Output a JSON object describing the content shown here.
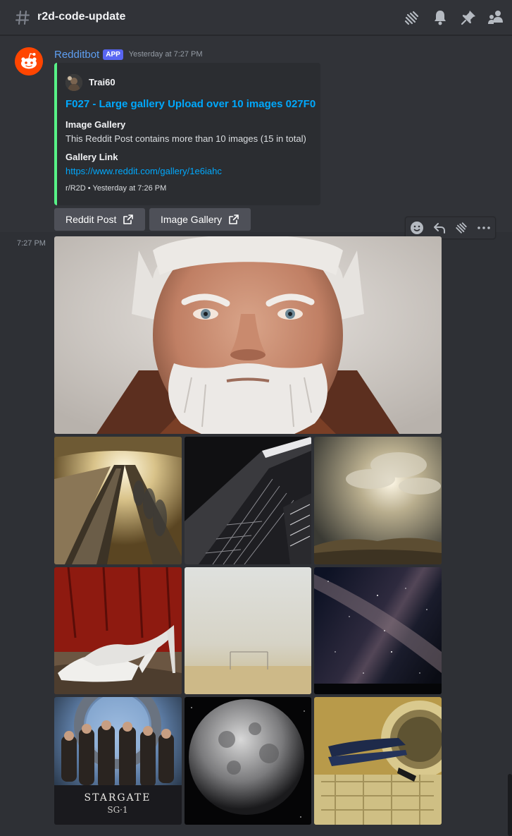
{
  "header": {
    "channel_name": "r2d-code-update",
    "icons": [
      "threads-icon",
      "bell-icon",
      "pin-icon",
      "members-icon"
    ]
  },
  "message": {
    "author": "Redditbot",
    "app_tag": "APP",
    "timestamp": "Yesterday at 7:27 PM",
    "side_time": "7:27 PM",
    "embed": {
      "accent_color": "#57f287",
      "author_name": "Trai60",
      "title": "F027 - Large gallery Upload over 10 images 027F0",
      "fields": [
        {
          "name": "Image Gallery",
          "value": "This Reddit Post contains more than 10 images (15 in total)"
        },
        {
          "name": "Gallery Link",
          "value": "https://www.reddit.com/gallery/1e6iahc"
        }
      ],
      "footer": "r/R2D • Yesterday at 7:26 PM"
    },
    "buttons": [
      {
        "label": "Reddit Post",
        "icon": "external-link-icon"
      },
      {
        "label": "Image Gallery",
        "icon": "external-link-icon"
      }
    ],
    "gallery": [
      {
        "name": "old-man-portrait-image",
        "alt": "portrait"
      },
      {
        "name": "escalator-image",
        "alt": "escalator"
      },
      {
        "name": "building-image",
        "alt": "building"
      },
      {
        "name": "clouds-image",
        "alt": "clouds"
      },
      {
        "name": "white-shoes-image",
        "alt": "shoes"
      },
      {
        "name": "foggy-desert-image",
        "alt": "fog"
      },
      {
        "name": "milky-way-image",
        "alt": "milky way"
      },
      {
        "name": "stargate-image",
        "alt": "stargate"
      },
      {
        "name": "moon-image",
        "alt": "moon"
      },
      {
        "name": "laundry-image",
        "alt": "laundry"
      }
    ],
    "stargate_logo_text": "STARGATE",
    "stargate_sub_text": "SG·1"
  },
  "toolbar": {
    "icons": [
      "add-reaction-icon",
      "reply-icon",
      "create-thread-icon",
      "more-icon"
    ]
  }
}
